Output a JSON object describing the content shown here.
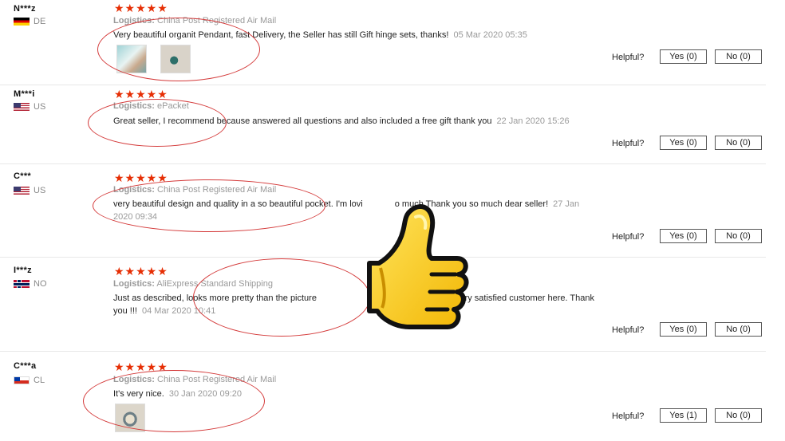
{
  "helpful_label": "Helpful?",
  "stars": "★★★★★",
  "logistics_label": "Logistics:",
  "reviews": [
    {
      "user": "N***z",
      "country": "DE",
      "logistics": "China Post Registered Air Mail",
      "text": "Very beautiful organit Pendant, fast Delivery, the Seller has still Gift hinge sets, thanks!",
      "date": "05 Mar 2020 05:35",
      "yes": "Yes (0)",
      "no": "No (0)"
    },
    {
      "user": "M***i",
      "country": "US",
      "logistics": "ePacket",
      "text": "Great seller, I recommend because answered all questions and also included a free gift thank you",
      "date": "22 Jan 2020 15:26",
      "yes": "Yes (0)",
      "no": "No (0)"
    },
    {
      "user": "C***",
      "country": "US",
      "logistics": "China Post Registered Air Mail",
      "text": "very beautiful design and quality in a so beautiful pocket. I'm lovi",
      "text_after": "o much Thank you so much dear seller!",
      "date_line1": "27 Jan",
      "date_line2": "2020 09:34",
      "yes": "Yes (0)",
      "no": "No (0)"
    },
    {
      "user": "I***z",
      "country": "NO",
      "logistics": "AliExpress Standard Shipping",
      "text": "Just as described, looks more pretty than the picture",
      "text_after": "ved a gift. Very satisfied customer here. Thank",
      "text_line2": "you !!!",
      "date": "04 Mar 2020 10:41",
      "yes": "Yes (0)",
      "no": "No (0)"
    },
    {
      "user": "C***a",
      "country": "CL",
      "logistics": "China Post Registered Air Mail",
      "text": "It's very nice.",
      "date": "30 Jan 2020 09:20",
      "yes": "Yes (1)",
      "no": "No (0)"
    }
  ]
}
